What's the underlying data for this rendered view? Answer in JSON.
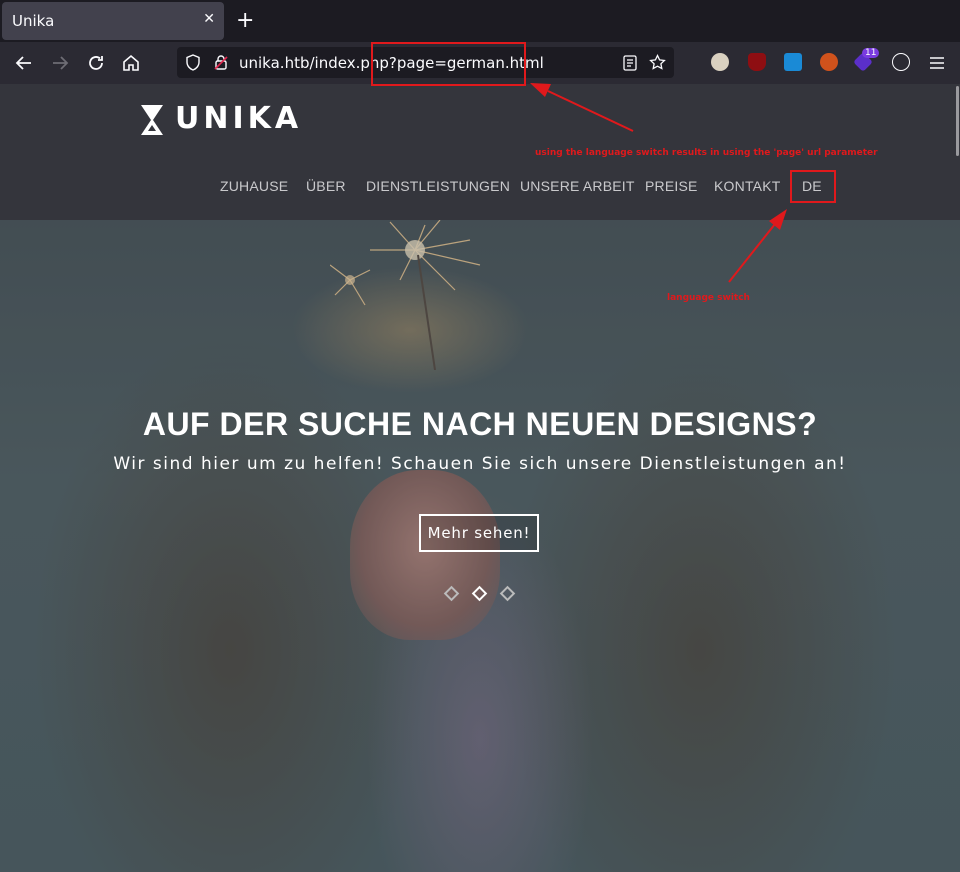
{
  "browser": {
    "tab_title": "Unika",
    "tab_close": "✕",
    "new_tab": "+",
    "url_host": "unika.htb/index.php",
    "url_query": "?page=german.html",
    "extension_badge": "11"
  },
  "site": {
    "logo_text": "UNIKA",
    "menu": [
      "ZUHAUSE",
      "ÜBER",
      "DIENSTLEISTUNGEN",
      "UNSERE ARBEIT",
      "PREISE",
      "KONTAKT",
      "DE"
    ],
    "hero_title": "AUF DER SUCHE NACH NEUEN DESIGNS?",
    "hero_subtitle": "Wir sind hier um zu helfen! Schauen Sie sich unsere Dienstleistungen an!",
    "hero_button": "Mehr sehen!",
    "slider_active_index": 1
  },
  "annotations": {
    "url_note": "using the language switch results in using the 'page' url parameter",
    "switch_note": "language switch"
  },
  "colors": {
    "annotation": "#e0191c",
    "header_bg": "#34353c",
    "browser_bg": "#1c1b22"
  }
}
